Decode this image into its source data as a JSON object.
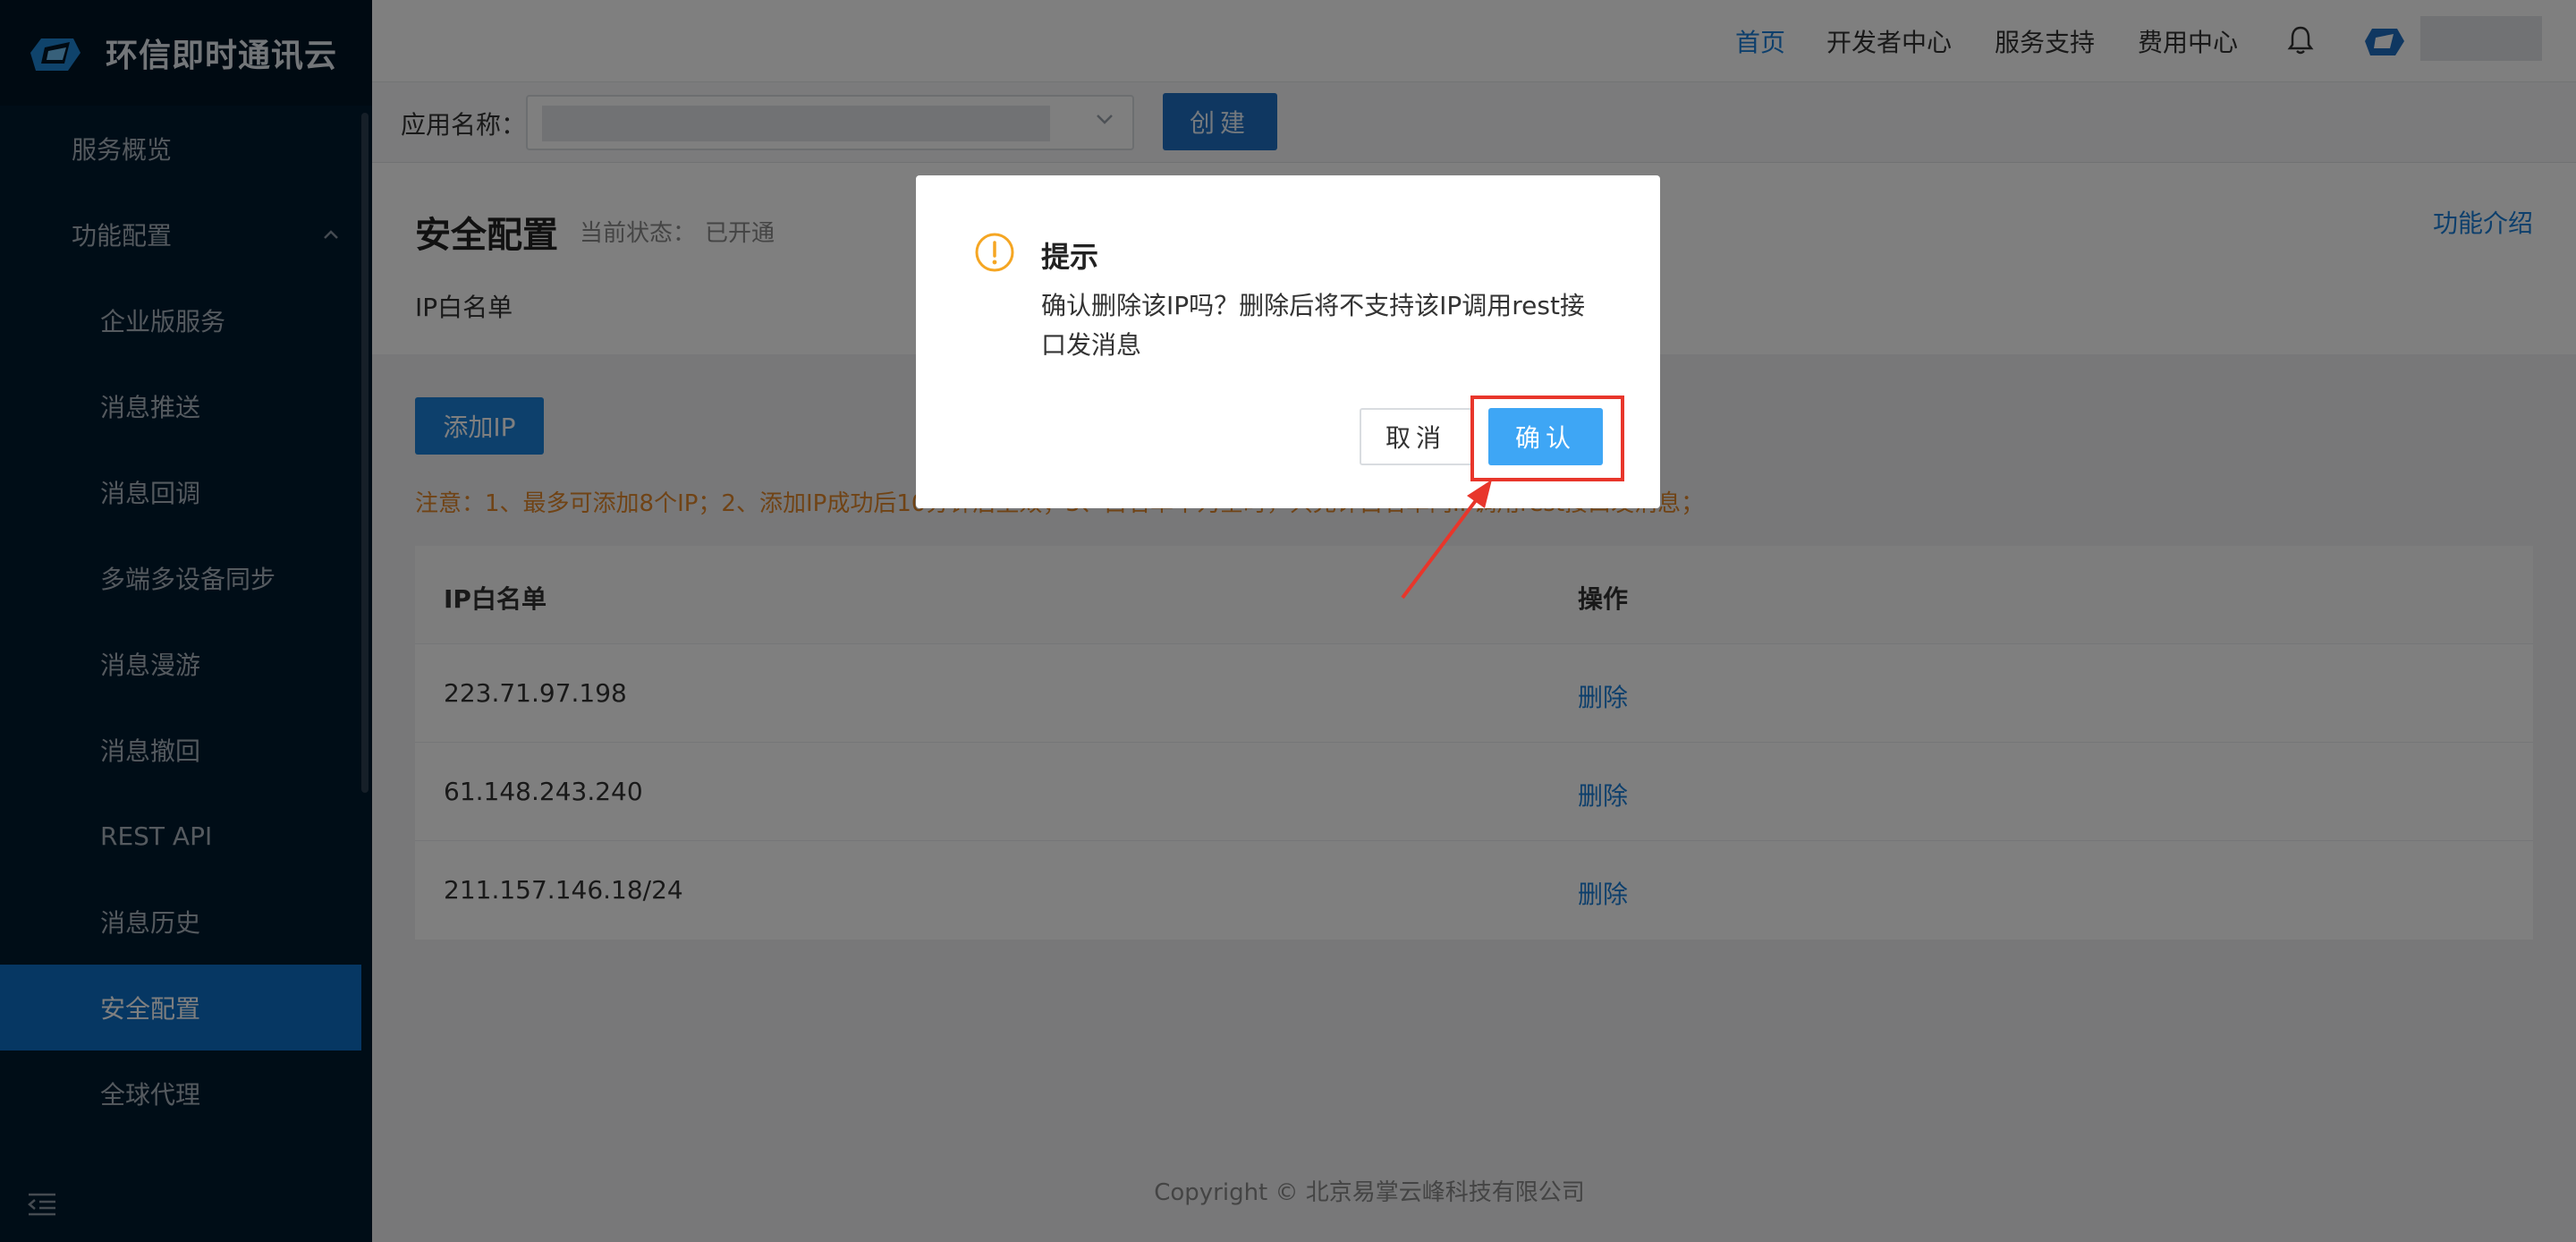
{
  "brand": {
    "name": "环信即时通讯云"
  },
  "sidebar": {
    "items": [
      {
        "label": "服务概览"
      },
      {
        "label": "功能配置"
      },
      {
        "label": "企业版服务"
      },
      {
        "label": "消息推送"
      },
      {
        "label": "消息回调"
      },
      {
        "label": "多端多设备同步"
      },
      {
        "label": "消息漫游"
      },
      {
        "label": "消息撤回"
      },
      {
        "label": "REST API"
      },
      {
        "label": "消息历史"
      },
      {
        "label": "安全配置"
      },
      {
        "label": "全球代理"
      }
    ],
    "active_item": "安全配置",
    "expanded_icon": "chevron-up-icon"
  },
  "topnav": {
    "links": [
      {
        "label": "首页"
      },
      {
        "label": "开发者中心"
      },
      {
        "label": "服务支持"
      },
      {
        "label": "费用中心"
      }
    ],
    "active_link": "首页"
  },
  "appbar": {
    "label": "应用名称：",
    "create_label": "创建"
  },
  "page": {
    "title": "安全配置",
    "status_label": "当前状态：",
    "status_value": "已开通",
    "feature_link": "功能介绍",
    "sub_tab": "IP白名单"
  },
  "content": {
    "add_button": "添加IP",
    "notice": "注意：1、最多可添加8个IP；2、添加IP成功后10分钟后生效；3、白名单不为空时，只允许白名单内IP调用rest接口发消息；",
    "table": {
      "headers": [
        "IP白名单",
        "操作"
      ],
      "rows": [
        {
          "ip": "223.71.97.198",
          "action": "删除"
        },
        {
          "ip": "61.148.243.240",
          "action": "删除"
        },
        {
          "ip": "211.157.146.18/24",
          "action": "删除"
        }
      ]
    },
    "footer": "Copyright © 北京易掌云峰科技有限公司"
  },
  "dialog": {
    "title": "提示",
    "message": "确认删除该IP吗？删除后将不支持该IP调用rest接口发消息",
    "cancel_label": "取消",
    "confirm_label": "确认"
  },
  "colors": {
    "sidebar_bg": "#001a2f",
    "active_blue": "#0d6fc7",
    "link_blue": "#1a7ed8",
    "confirm_blue": "#3ea6f5",
    "warning_orange": "#f5a623",
    "notice_orange": "#e0862a",
    "highlight_red": "#e8362b"
  }
}
